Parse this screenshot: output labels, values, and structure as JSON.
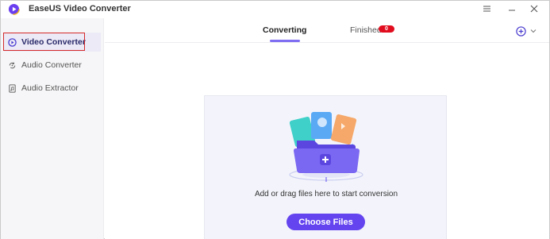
{
  "app": {
    "title": "EaseUS Video Converter",
    "accent_color": "#6444ef"
  },
  "titlebar": {
    "menu_icon": "hamburger-icon",
    "minimize_icon": "minimize-icon",
    "close_icon": "close-icon"
  },
  "sidebar": {
    "items": [
      {
        "label": "Video Converter",
        "icon": "video-play-icon",
        "active": true
      },
      {
        "label": "Audio Converter",
        "icon": "audio-refresh-icon",
        "active": false
      },
      {
        "label": "Audio Extractor",
        "icon": "audio-file-icon",
        "active": false
      }
    ]
  },
  "tabs": {
    "converting": "Converting",
    "finished": "Finished",
    "finished_count": "0"
  },
  "main": {
    "drop_text": "Add or drag files here to start conversion",
    "choose_label": "Choose Files"
  }
}
